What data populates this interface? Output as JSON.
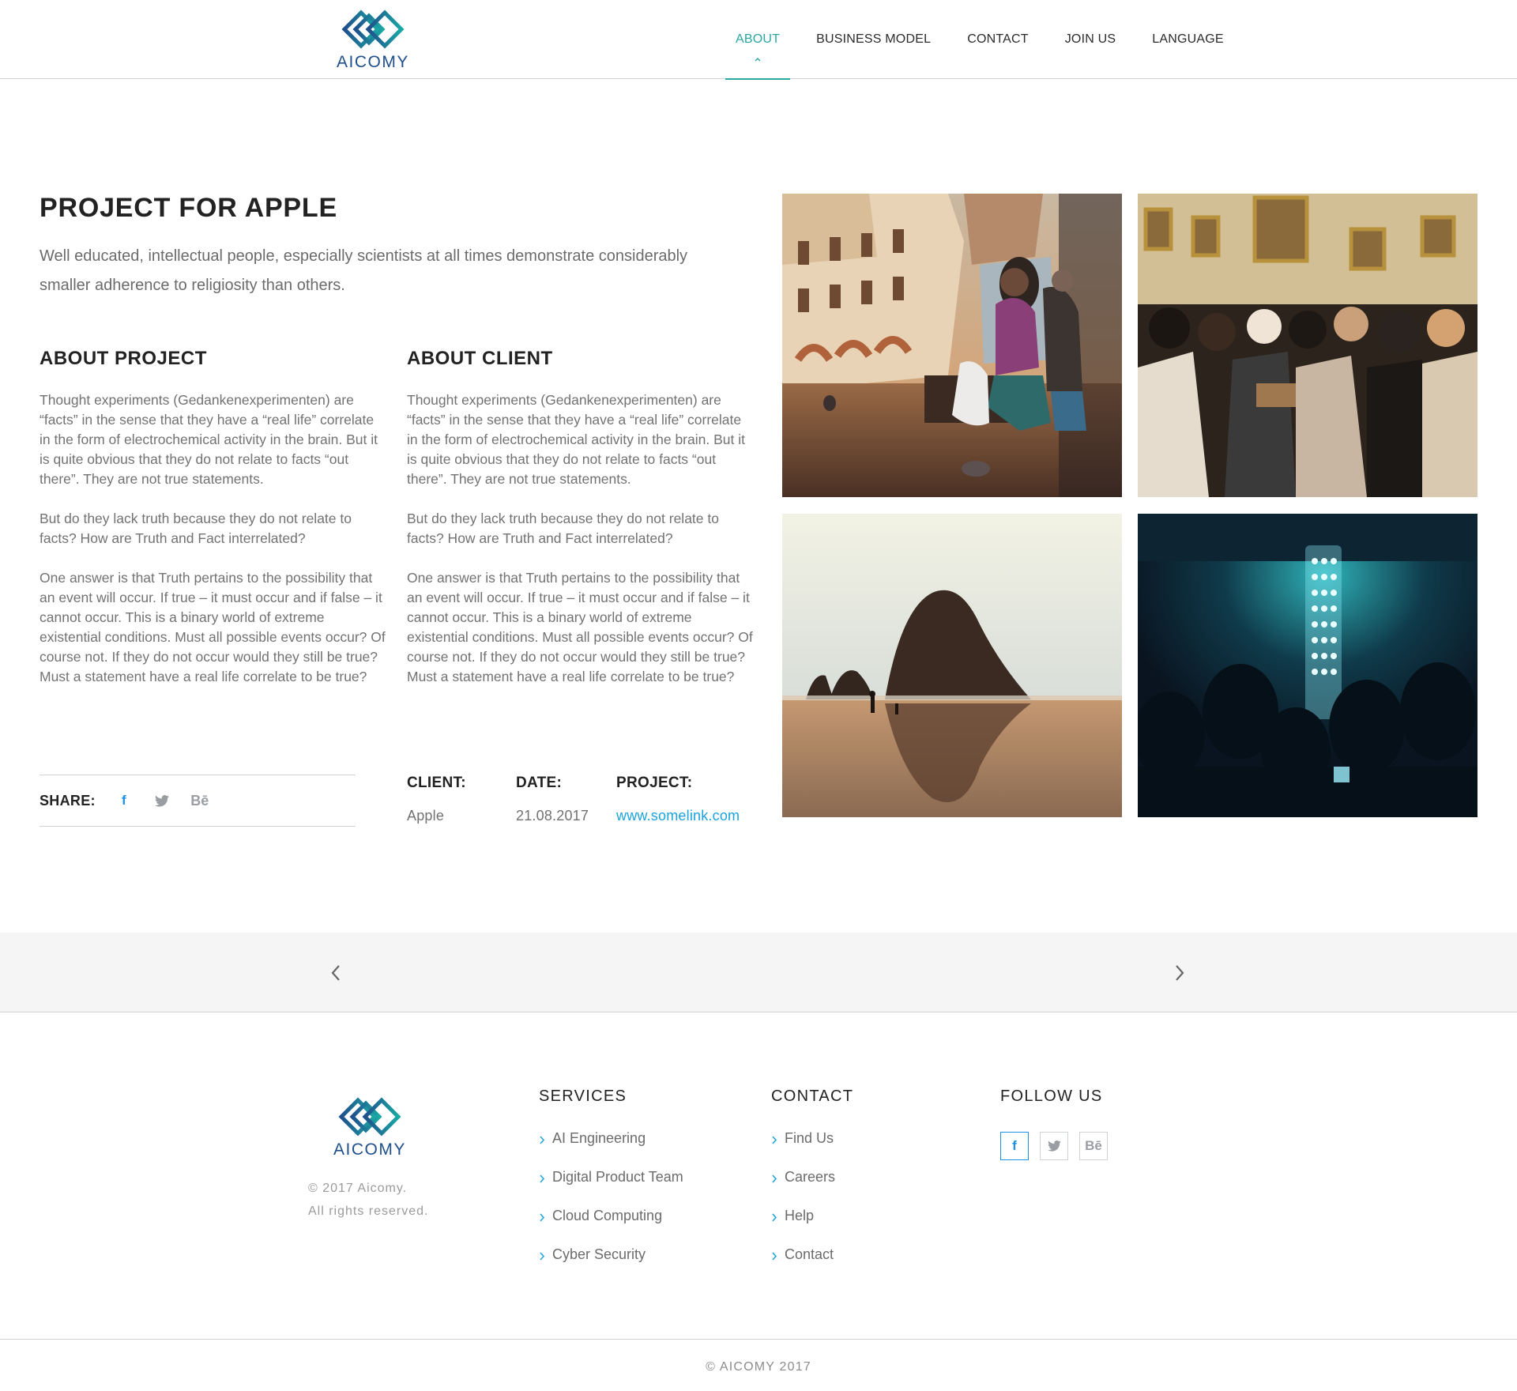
{
  "brand": {
    "name": "AICOMY",
    "accent_color": "#2aa6a0",
    "logo_color": "#1f4f8c",
    "link_color": "#1aa3dd"
  },
  "nav": {
    "items": [
      {
        "label": "ABOUT",
        "active": true
      },
      {
        "label": "BUSINESS MODEL",
        "active": false
      },
      {
        "label": "CONTACT",
        "active": false
      },
      {
        "label": "JOIN US",
        "active": false
      },
      {
        "label": "LANGUAGE",
        "active": false
      }
    ]
  },
  "project": {
    "title": "PROJECT FOR APPLE",
    "lead": "Well educated, intellectual people, especially scientists at all times demonstrate considerably smaller adherence to religiosity than others."
  },
  "about_project": {
    "heading": "ABOUT PROJECT",
    "paragraphs": [
      "Thought experiments (Gedankenexperimenten) are “facts” in the sense that they have a “real life” correlate in the form of electrochemical activity in the brain. But it is quite obvious that they do not relate to facts “out there”. They are not true statements.",
      "But do they lack truth because they do not relate to facts? How are Truth and Fact interrelated?",
      "One answer is that Truth pertains to the possibility that an event will occur. If true – it must occur and if false – it cannot occur. This is a binary world of extreme existential conditions. Must all possible events occur? Of course not. If they do not occur would they still be true? Must a statement have a real life correlate to be true?"
    ]
  },
  "about_client": {
    "heading": "ABOUT CLIENT",
    "paragraphs": [
      "Thought experiments (Gedankenexperimenten) are “facts” in the sense that they have a “real life” correlate in the form of electrochemical activity in the brain. But it is quite obvious that they do not relate to facts “out there”. They are not true statements.",
      "But do they lack truth because they do not relate to facts? How are Truth and Fact interrelated?",
      "One answer is that Truth pertains to the possibility that an event will occur. If true – it must occur and if false – it cannot occur. This is a binary world of extreme existential conditions. Must all possible events occur? Of course not. If they do not occur would they still be true? Must a statement have a real life correlate to be true?"
    ]
  },
  "share": {
    "label": "SHARE:",
    "icons": [
      "facebook-icon",
      "twitter-icon",
      "behance-icon"
    ]
  },
  "meta": {
    "client_label": "CLIENT:",
    "client_value": "Apple",
    "date_label": "DATE:",
    "date_value": "21.08.2017",
    "project_label": "PROJECT:",
    "project_value": "www.somelink.com"
  },
  "gallery": [
    {
      "subject": "town-square-photo"
    },
    {
      "subject": "museum-crowd-photo"
    },
    {
      "subject": "sea-stack-beach-photo"
    },
    {
      "subject": "concert-light-photo"
    }
  ],
  "pager": {
    "prev_icon": "chevron-left-icon",
    "next_icon": "chevron-right-icon"
  },
  "footer": {
    "copyright_line1": "© 2017 Aicomy.",
    "copyright_line2": "All rights reserved.",
    "services": {
      "heading": "SERVICES",
      "items": [
        "AI Engineering",
        "Digital Product Team",
        "Cloud Computing",
        "Cyber Security"
      ]
    },
    "contact": {
      "heading": "CONTACT",
      "items": [
        "Find Us",
        "Careers",
        "Help",
        "Contact"
      ]
    },
    "follow": {
      "heading": "FOLLOW US",
      "icons": [
        "facebook-icon",
        "twitter-icon",
        "behance-icon"
      ]
    },
    "bottom": "© AICOMY 2017"
  }
}
